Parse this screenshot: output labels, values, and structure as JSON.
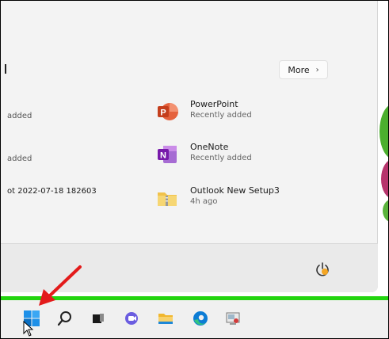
{
  "start_menu": {
    "recommended": {
      "more_label": "More",
      "more_chevron": "›",
      "left_items": [
        {
          "text": "added"
        },
        {
          "text": "added"
        },
        {
          "text": "ot 2022-07-18 182603"
        }
      ],
      "items": [
        {
          "title": "PowerPoint",
          "subtitle": "Recently added",
          "icon": "powerpoint-icon"
        },
        {
          "title": "OneNote",
          "subtitle": "Recently added",
          "icon": "onenote-icon"
        },
        {
          "title": "Outlook New Setup3",
          "subtitle": "4h ago",
          "icon": "zip-folder-icon"
        }
      ]
    },
    "footer": {
      "power_icon": "power-icon"
    }
  },
  "taskbar": {
    "icons": [
      "windows-start-icon",
      "search-icon",
      "task-view-icon",
      "chat-icon",
      "file-explorer-icon",
      "edge-icon",
      "app-icon"
    ],
    "highlight_color": "#22d40f"
  },
  "annotation": {
    "arrow_color": "#e31b1b"
  },
  "colors": {
    "powerpoint": "#c43e1c",
    "onenote": "#7719aa",
    "accent": "#0067c0"
  }
}
